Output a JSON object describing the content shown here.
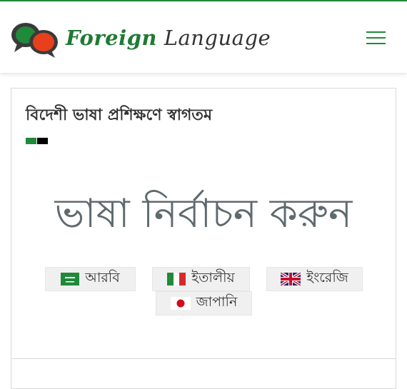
{
  "header": {
    "brand_part1": "Foreign",
    "brand_part2": "Language",
    "accent_color": "#1f8a3a",
    "logo_icon": "speech-bubbles-icon",
    "menu_icon": "hamburger-icon"
  },
  "main": {
    "title": "বিদেশী ভাষা প্রশিক্ষণে স্বাগতম",
    "select_heading": "ভাষা নির্বাচন করুন",
    "languages": [
      {
        "label": "আরবি",
        "flag": "saudi-arabia-flag-icon"
      },
      {
        "label": "ইতালীয়",
        "flag": "italy-flag-icon"
      },
      {
        "label": "ইংরেজি",
        "flag": "uk-flag-icon"
      },
      {
        "label": "জাপানি",
        "flag": "japan-flag-icon"
      }
    ]
  }
}
